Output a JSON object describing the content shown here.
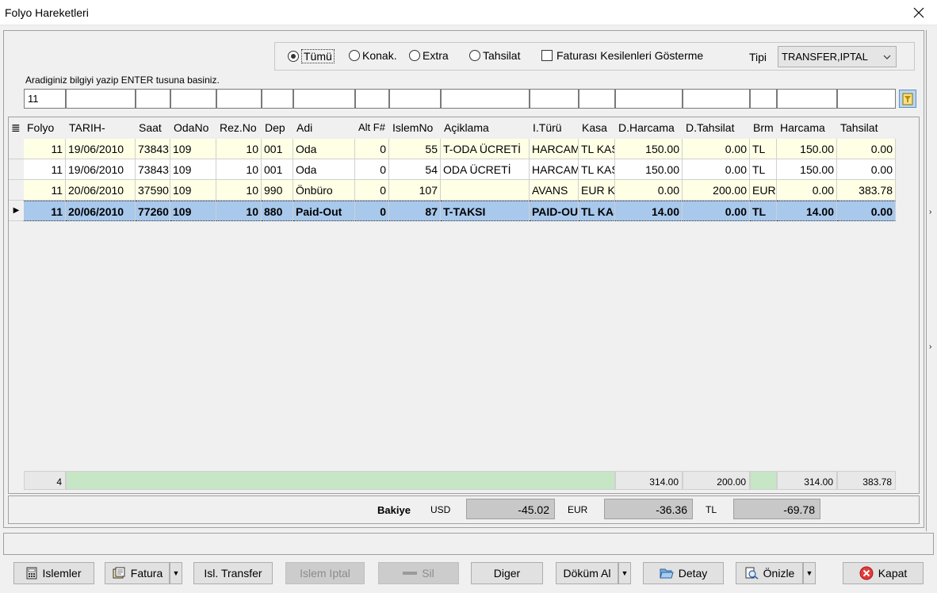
{
  "window": {
    "title": "Folyo Hareketleri"
  },
  "filters": {
    "radios": [
      {
        "label": "Tümü",
        "checked": true
      },
      {
        "label": "Konak.",
        "checked": false
      },
      {
        "label": "Extra",
        "checked": false
      },
      {
        "label": "Tahsilat",
        "checked": false
      }
    ],
    "checkbox_label": "Faturası Kesilenleri Gösterme",
    "tipi_label": "Tipi",
    "tipi_value": "TRANSFER,IPTAL"
  },
  "search": {
    "hint": "Aradiginiz bilgiyi yazip ENTER tusuna basiniz.",
    "first_value": "11"
  },
  "grid": {
    "columns": [
      "Folyo",
      "TARIH-",
      "Saat",
      "OdaNo",
      "Rez.No",
      "Dep",
      "Adi",
      "Alt F#",
      "IslemNo",
      "Açiklama",
      "I.Türü",
      "Kasa",
      "D.Harcama",
      "D.Tahsilat",
      "Brm",
      "Harcama",
      "Tahsilat"
    ],
    "rows": [
      [
        "11",
        "19/06/2010",
        "73843",
        "109",
        "10",
        "001",
        "Oda",
        "0",
        "55",
        "T-ODA ÜCRETİ",
        "HARCAMA",
        "TL KASA",
        "150.00",
        "0.00",
        "TL",
        "150.00",
        "0.00"
      ],
      [
        "11",
        "19/06/2010",
        "73843",
        "109",
        "10",
        "001",
        "Oda",
        "0",
        "54",
        "ODA ÜCRETİ",
        "HARCAMA",
        "TL KASA",
        "150.00",
        "0.00",
        "TL",
        "150.00",
        "0.00"
      ],
      [
        "11",
        "20/06/2010",
        "37590",
        "109",
        "10",
        "990",
        "Önbüro",
        "0",
        "107",
        "",
        "AVANS",
        "EUR KASA",
        "0.00",
        "200.00",
        "EUR",
        "0.00",
        "383.78"
      ],
      [
        "11",
        "20/06/2010",
        "77260",
        "109",
        "10",
        "880",
        "Paid-Out",
        "0",
        "87",
        "T-TAKSI",
        "PAID-OUT",
        "TL KASA",
        "14.00",
        "0.00",
        "TL",
        "14.00",
        "0.00"
      ]
    ],
    "footer": {
      "count": "4",
      "d_harcama": "314.00",
      "d_tahsilat": "200.00",
      "harcama": "314.00",
      "tahsilat": "383.78"
    }
  },
  "bakiye": {
    "label": "Bakiye",
    "usd_label": "USD",
    "usd_value": "-45.02",
    "eur_label": "EUR",
    "eur_value": "-36.36",
    "tl_label": "TL",
    "tl_value": "-69.78"
  },
  "buttons": {
    "islemler": "Islemler",
    "fatura": "Fatura",
    "isl_transfer": "Isl. Transfer",
    "islem_iptal": "Islem Iptal",
    "sil": "Sil",
    "diger": "Diger",
    "dokum_al": "Döküm Al",
    "detay": "Detay",
    "onizle": "Önizle",
    "kapat": "Kapat"
  }
}
